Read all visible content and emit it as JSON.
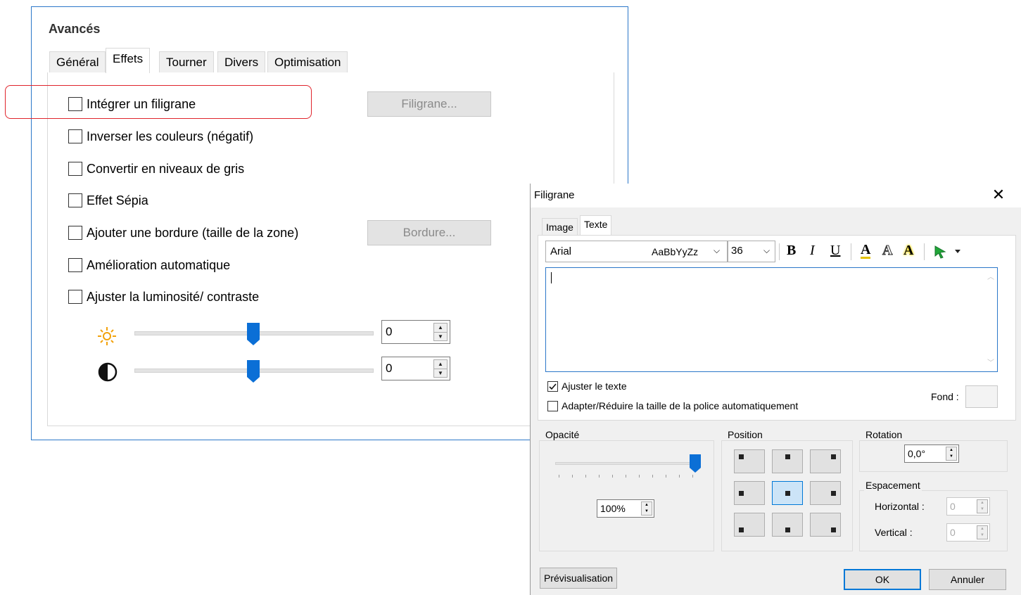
{
  "advanced": {
    "title": "Avancés",
    "tabs": [
      {
        "label": "Général"
      },
      {
        "label": "Effets"
      },
      {
        "label": "Tourner"
      },
      {
        "label": "Divers"
      },
      {
        "label": "Optimisation"
      }
    ],
    "options": [
      {
        "label": "Intégrer un filigrane",
        "checked": false
      },
      {
        "label": "Inverser les couleurs (négatif)",
        "checked": false
      },
      {
        "label": "Convertir en niveaux de gris",
        "checked": false
      },
      {
        "label": "Effet Sépia",
        "checked": false
      },
      {
        "label": "Ajouter une bordure (taille de la zone)",
        "checked": false
      },
      {
        "label": "Amélioration automatique",
        "checked": false
      },
      {
        "label": "Ajuster la luminosité/ contraste",
        "checked": false
      }
    ],
    "watermark_button": "Filigrane...",
    "border_button": "Bordure...",
    "brightness": {
      "icon": "sun-icon",
      "value": "0"
    },
    "contrast": {
      "icon": "contrast-icon",
      "value": "0"
    },
    "highlight_color": "#e0242c"
  },
  "watermark": {
    "title": "Filigrane",
    "tabs": [
      {
        "label": "Image"
      },
      {
        "label": "Texte"
      }
    ],
    "font": {
      "name": "Arial",
      "preview": "AaBbYyZz",
      "size": "36"
    },
    "toolbar": {
      "bold": "B",
      "italic": "I",
      "underline": "U",
      "color": "A",
      "outline": "A",
      "highlight": "A"
    },
    "fit_text": {
      "label": "Ajuster le texte",
      "checked": true
    },
    "auto_font": {
      "label": "Adapter/Réduire la taille de la police automatiquement",
      "checked": false
    },
    "background_label": "Fond :",
    "opacity": {
      "label": "Opacité",
      "value": "100%"
    },
    "position": {
      "label": "Position",
      "selected": "middle-center"
    },
    "rotation": {
      "label": "Rotation",
      "value": "0,0°"
    },
    "spacing": {
      "label": "Espacement",
      "horizontal_label": "Horizontal :",
      "horizontal_value": "0",
      "vertical_label": "Vertical :",
      "vertical_value": "0"
    },
    "preview_button": "Prévisualisation",
    "ok_button": "OK",
    "cancel_button": "Annuler",
    "accent": "#0078d7"
  }
}
